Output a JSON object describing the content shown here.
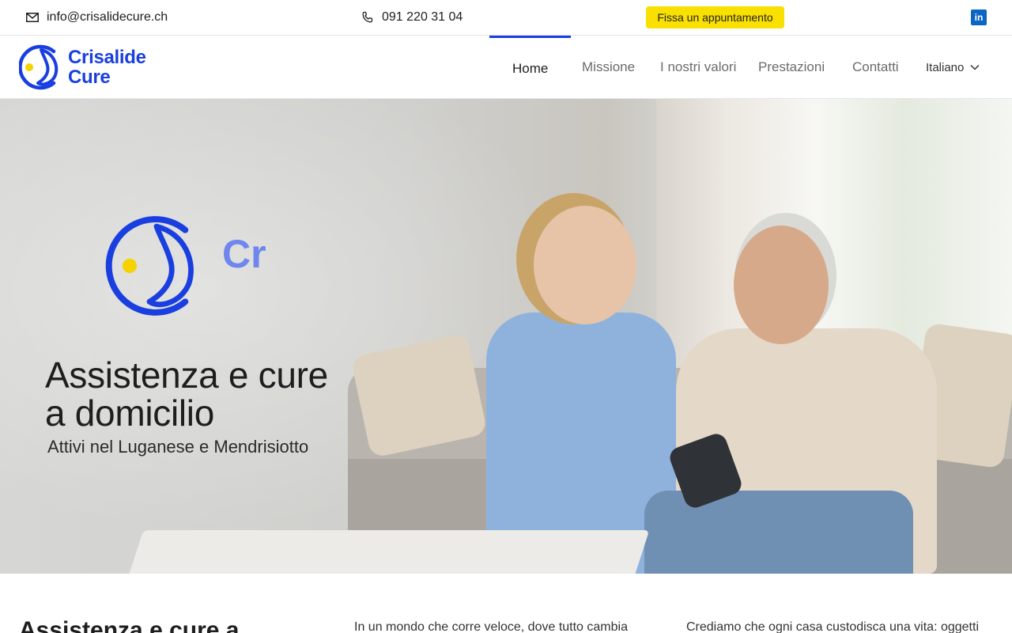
{
  "topbar": {
    "email": "info@crisalidecure.ch",
    "phone": "091 220 31 04",
    "cta_label": "Fissa un appuntamento",
    "linkedin_label": "in",
    "email_icon": "mail-icon",
    "phone_icon": "phone-icon"
  },
  "brand": {
    "name_line1": "Crisalide",
    "name_line2": "Cure",
    "color": "#1a3fe0",
    "dot_color": "#f5d200"
  },
  "nav": {
    "items": [
      {
        "label": "Home"
      },
      {
        "label": "Missione"
      },
      {
        "label": "I nostri valori"
      },
      {
        "label": "Prestazioni"
      },
      {
        "label": "Contatti"
      }
    ],
    "active": "Home",
    "language": "Italiano"
  },
  "hero": {
    "logo_text": "Cr",
    "title_line1": "Assistenza e cure",
    "title_line2": "a domicilio",
    "subtitle": "Attivi nel Luganese e Mendrisiotto"
  },
  "intro": {
    "title": "Assistenza e cure a",
    "col1": "In un mondo che corre veloce, dove tutto cambia",
    "col2": "Crediamo che ogni casa custodisca una vita: oggetti"
  },
  "colors": {
    "accent": "#1a3fe0",
    "cta": "#f9e000",
    "linkedin": "#0a66c2"
  }
}
